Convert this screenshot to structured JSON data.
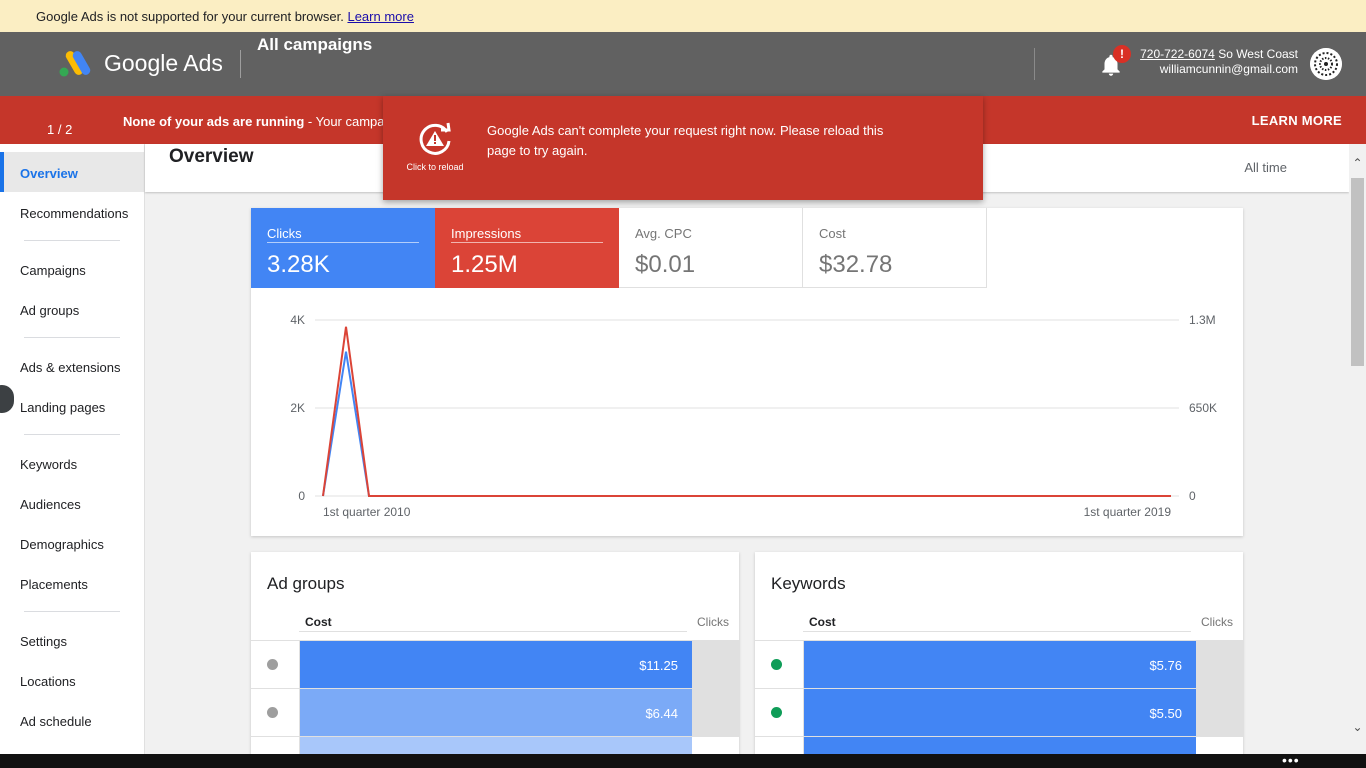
{
  "browser_warning": {
    "text": "Google Ads is not supported for your current browser.",
    "link": "Learn more"
  },
  "header": {
    "logo_text": "Google Ads",
    "page_title": "All campaigns",
    "notification_badge": "!",
    "account_phone": "720-722-6074",
    "account_name": "So West Coast",
    "account_email": "williamcunnin@gmail.com"
  },
  "alert_bar": {
    "pager": "1 / 2",
    "message_bold": "None of your ads are running",
    "message_rest": " - Your campaign",
    "learn_more": "LEARN MORE"
  },
  "error_popup": {
    "reload_label": "Click to reload",
    "message": "Google Ads can't complete your request right now. Please reload this page to try again."
  },
  "sidebar": {
    "items": [
      {
        "label": "Overview",
        "active": true
      },
      {
        "label": "Recommendations"
      },
      {
        "label": "Campaigns"
      },
      {
        "label": "Ad groups"
      },
      {
        "label": "Ads & extensions"
      },
      {
        "label": "Landing pages"
      },
      {
        "label": "Keywords"
      },
      {
        "label": "Audiences"
      },
      {
        "label": "Demographics"
      },
      {
        "label": "Placements"
      },
      {
        "label": "Settings"
      },
      {
        "label": "Locations"
      },
      {
        "label": "Ad schedule"
      }
    ]
  },
  "main": {
    "title": "Overview",
    "date_range": "All time"
  },
  "metrics": [
    {
      "label": "Clicks",
      "value": "3.28K"
    },
    {
      "label": "Impressions",
      "value": "1.25M"
    },
    {
      "label": "Avg. CPC",
      "value": "$0.01"
    },
    {
      "label": "Cost",
      "value": "$32.78"
    }
  ],
  "colors": {
    "clicks": "#4285f4",
    "impressions": "#db4437",
    "alert": "#c5362a",
    "header": "#616161",
    "enabled": "#0f9d58",
    "paused": "#9e9e9e"
  },
  "chart_data": {
    "type": "line",
    "x_labels": [
      "1st quarter 2010",
      "1st quarter 2019"
    ],
    "left_axis_ticks": [
      "4K",
      "2K",
      "0"
    ],
    "right_axis_ticks": [
      "1.3M",
      "650K",
      "0"
    ],
    "ylim_left": [
      0,
      4000
    ],
    "ylim_right": [
      0,
      1300000
    ],
    "grid": true,
    "series": [
      {
        "name": "Clicks",
        "color": "#4285f4",
        "values": [
          0,
          3280,
          0,
          0
        ]
      },
      {
        "name": "Impressions",
        "color": "#db4437",
        "values": [
          0,
          1250000,
          0,
          0
        ]
      }
    ]
  },
  "ad_groups": {
    "title": "Ad groups",
    "col_cost": "Cost",
    "col_clicks": "Clicks",
    "rows": [
      {
        "status": "paused",
        "cost": "$11.25",
        "fraction": 1.0,
        "color": "#4285f4"
      },
      {
        "status": "paused",
        "cost": "$6.44",
        "fraction": 1.0,
        "color": "#7baaf7"
      }
    ]
  },
  "keywords": {
    "title": "Keywords",
    "col_cost": "Cost",
    "col_clicks": "Clicks",
    "rows": [
      {
        "status": "enabled",
        "cost": "$5.76",
        "fraction": 1.0,
        "color": "#4285f4"
      },
      {
        "status": "enabled",
        "cost": "$5.50",
        "fraction": 1.0,
        "color": "#4285f4"
      }
    ]
  }
}
